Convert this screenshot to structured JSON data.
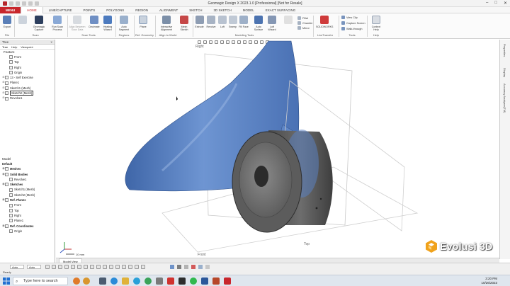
{
  "window": {
    "title": "Geomagic Design X 2023.1.0 [Professional] [Not for Resale]",
    "controls": [
      "–",
      "□",
      "✕"
    ]
  },
  "ribbon_tabs": [
    "MENU",
    "HOME",
    "LINE/CAPTURE",
    "POINTS",
    "POLYGONS",
    "REGION",
    "ALIGNMENT",
    "SKETCH",
    "3D SKETCH",
    "MODEL",
    "EXACT SURFACING"
  ],
  "active_tab": "HOME",
  "ribbon": {
    "file": {
      "label": "File",
      "buttons": [
        "Export"
      ]
    },
    "scan": {
      "label": "Scan",
      "buttons": [
        "Geomagic Capture",
        "Run Scan Process"
      ]
    },
    "scan_tools": {
      "label": "Scan Tools",
      "buttons": [
        "Align Between Scan Data",
        "Decimate",
        "Healing Wizard"
      ]
    },
    "regions": {
      "label": "Regions",
      "buttons": [
        "Auto Segment"
      ]
    },
    "ref_geometry": {
      "label": "Ref. Geometry",
      "buttons": [
        "Plane"
      ]
    },
    "align": {
      "label": "Align to World",
      "buttons": [
        "Interactive Alignment",
        "Mesh Sketch"
      ]
    },
    "modeling": {
      "label": "Modeling Tools",
      "buttons": [
        "Extrude",
        "Revolve",
        "Loft",
        "Sweep",
        "Fill Face",
        "Auto Surface",
        "Loft Wizard",
        "Fillet",
        "Chamfer",
        "Mirror",
        "Shell"
      ]
    },
    "livetransfer": {
      "label": "LiveTransfer",
      "buttons": [
        "SOLIDWORKS"
      ]
    },
    "tools": {
      "label": "Tools",
      "items": [
        "View Clip",
        "Capture Screen",
        "Walk-through"
      ]
    },
    "help": {
      "label": "Help",
      "buttons": [
        "Context Help"
      ]
    }
  },
  "left_panel": {
    "tree_header": "Tree",
    "tree_tabs": [
      "Tree",
      "Help",
      "Viewpoint"
    ],
    "feature_label": "Feature",
    "features": [
      {
        "label": "Front",
        "indent": 1
      },
      {
        "label": "Top",
        "indent": 1
      },
      {
        "label": "Right",
        "indent": 1
      },
      {
        "label": "Origin",
        "indent": 1
      },
      {
        "label": "13 - Self Exercise",
        "indent": 0
      },
      {
        "label": "Plane1",
        "indent": 0
      },
      {
        "label": "Sketch1 (Mesh)",
        "indent": 0
      },
      {
        "label": "Sketch2 (Mesh)",
        "indent": 0,
        "selected": true
      },
      {
        "label": "Revolve1",
        "indent": 0
      }
    ],
    "model_label": "Model",
    "model_default": "Default",
    "model_tree": [
      {
        "label": "Meshes",
        "bold": true,
        "indent": 0
      },
      {
        "label": "Solid Bodies",
        "bold": true,
        "indent": 0
      },
      {
        "label": "Revolve1",
        "indent": 1
      },
      {
        "label": "Sketches",
        "bold": true,
        "indent": 0
      },
      {
        "label": "Sketch1 (Mesh)",
        "indent": 1
      },
      {
        "label": "Sketch2 (Mesh)",
        "indent": 1
      },
      {
        "label": "Ref. Planes",
        "bold": true,
        "indent": 0
      },
      {
        "label": "Front",
        "indent": 1
      },
      {
        "label": "Top",
        "indent": 1
      },
      {
        "label": "Right",
        "indent": 1
      },
      {
        "label": "Plane1",
        "indent": 1
      },
      {
        "label": "Ref. Coordinates",
        "bold": true,
        "indent": 0
      },
      {
        "label": "Origin",
        "indent": 1
      }
    ]
  },
  "right_strip": [
    "Properties",
    "Display",
    "Accuracy Analyzer(TM)"
  ],
  "viewport": {
    "tab": "Model View",
    "plane_labels": [
      "Right",
      "Top",
      "Front"
    ],
    "scale": "10 mm"
  },
  "status": {
    "auto_field": "Auto",
    "auto_field2": "Auto",
    "ready": "Ready",
    "time_hint": "0:00:00:00"
  },
  "taskbar": {
    "search_placeholder": "Type here to search",
    "time": "3:20 PM",
    "date": "10/26/2023"
  },
  "watermark": "Evolusi 3D",
  "colors": {
    "menu_red": "#c8262c",
    "mesh_blue": "#5b86c8",
    "solid_gray": "#6e6e6e"
  }
}
